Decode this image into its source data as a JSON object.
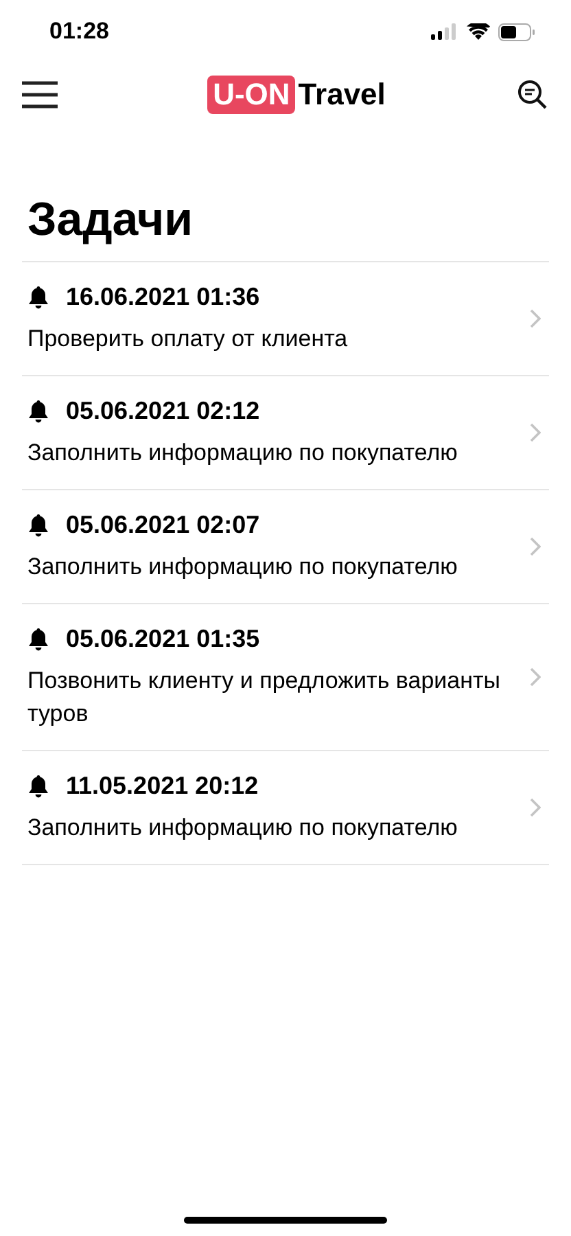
{
  "status_bar": {
    "time": "01:28"
  },
  "header": {
    "logo_badge": "U-ON",
    "logo_text": "Travel"
  },
  "title": "Задачи",
  "tasks": [
    {
      "datetime": "16.06.2021 01:36",
      "text": "Проверить оплату от клиента"
    },
    {
      "datetime": "05.06.2021 02:12",
      "text": "Заполнить информацию по покупателю"
    },
    {
      "datetime": "05.06.2021 02:07",
      "text": "Заполнить информацию по покупателю"
    },
    {
      "datetime": "05.06.2021 01:35",
      "text": "Позвонить клиенту и предложить варианты туров"
    },
    {
      "datetime": "11.05.2021 20:12",
      "text": "Заполнить информацию по покупателю"
    }
  ]
}
